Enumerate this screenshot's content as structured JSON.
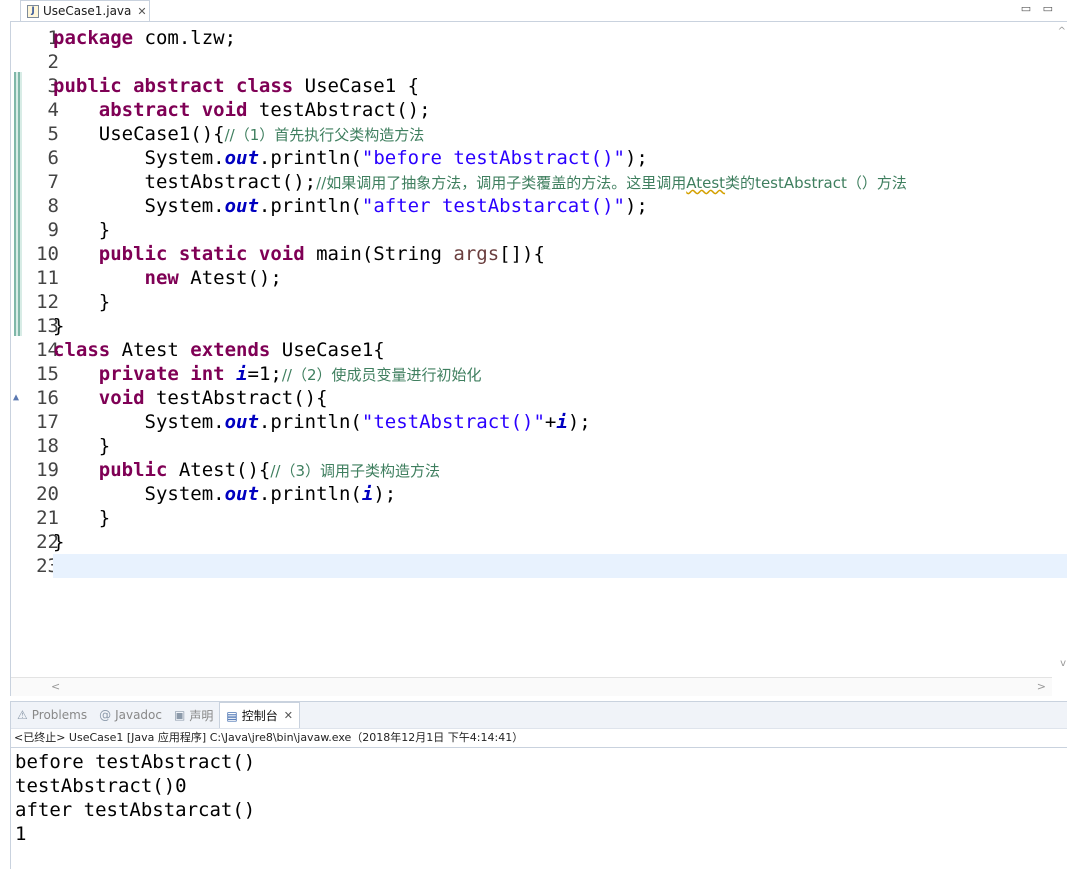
{
  "editor_tab": {
    "filename": "UseCase1.java",
    "close": "✕",
    "icon": "java-file-icon"
  },
  "window_controls": "▭ ▭",
  "code": {
    "lines": [
      {
        "n": "1",
        "segs": [
          {
            "t": "package",
            "c": "kw"
          },
          {
            "t": " com.lzw;",
            "c": ""
          }
        ]
      },
      {
        "n": "2",
        "segs": []
      },
      {
        "n": "3",
        "segs": [
          {
            "t": "public abstract class",
            "c": "kw"
          },
          {
            "t": " UseCase1 {",
            "c": ""
          }
        ]
      },
      {
        "n": "4",
        "segs": [
          {
            "t": "    ",
            "c": ""
          },
          {
            "t": "abstract void",
            "c": "kw"
          },
          {
            "t": " testAbstract();",
            "c": ""
          }
        ]
      },
      {
        "n": "5",
        "segs": [
          {
            "t": "    UseCase1(){",
            "c": ""
          },
          {
            "t": "//（1）首先执行父类构造方法",
            "c": "cm"
          }
        ]
      },
      {
        "n": "6",
        "segs": [
          {
            "t": "        System.",
            "c": ""
          },
          {
            "t": "out",
            "c": "fd"
          },
          {
            "t": ".println(",
            "c": ""
          },
          {
            "t": "\"before testAbstract()\"",
            "c": "st"
          },
          {
            "t": ");",
            "c": ""
          }
        ]
      },
      {
        "n": "7",
        "segs": [
          {
            "t": "        testAbstract();",
            "c": ""
          },
          {
            "t": "//如果调用了抽象方法，调用子类覆盖的方法。这里调用",
            "c": "cm"
          },
          {
            "t": "Atest",
            "c": "cm m sq"
          },
          {
            "t": "类的",
            "c": "cm"
          },
          {
            "t": "testAbstract",
            "c": "cm m"
          },
          {
            "t": "（）方法",
            "c": "cm"
          }
        ]
      },
      {
        "n": "8",
        "segs": [
          {
            "t": "        System.",
            "c": ""
          },
          {
            "t": "out",
            "c": "fd"
          },
          {
            "t": ".println(",
            "c": ""
          },
          {
            "t": "\"after testAbstarcat()\"",
            "c": "st"
          },
          {
            "t": ");",
            "c": ""
          }
        ]
      },
      {
        "n": "9",
        "segs": [
          {
            "t": "    }",
            "c": ""
          }
        ]
      },
      {
        "n": "10",
        "segs": [
          {
            "t": "    ",
            "c": ""
          },
          {
            "t": "public static void",
            "c": "kw"
          },
          {
            "t": " main(String ",
            "c": ""
          },
          {
            "t": "args",
            "c": "vr"
          },
          {
            "t": "[]){",
            "c": ""
          }
        ]
      },
      {
        "n": "11",
        "segs": [
          {
            "t": "        ",
            "c": ""
          },
          {
            "t": "new",
            "c": "kw"
          },
          {
            "t": " Atest();",
            "c": ""
          }
        ]
      },
      {
        "n": "12",
        "segs": [
          {
            "t": "    }",
            "c": ""
          }
        ]
      },
      {
        "n": "13",
        "segs": [
          {
            "t": "}",
            "c": ""
          }
        ]
      },
      {
        "n": "14",
        "segs": [
          {
            "t": "class",
            "c": "kw"
          },
          {
            "t": " Atest ",
            "c": ""
          },
          {
            "t": "extends",
            "c": "kw"
          },
          {
            "t": " UseCase1{",
            "c": ""
          }
        ]
      },
      {
        "n": "15",
        "segs": [
          {
            "t": "    ",
            "c": ""
          },
          {
            "t": "private int",
            "c": "kw"
          },
          {
            "t": " ",
            "c": ""
          },
          {
            "t": "i",
            "c": "fd"
          },
          {
            "t": "=1;",
            "c": ""
          },
          {
            "t": "//（2）使成员变量进行初始化",
            "c": "cm"
          }
        ]
      },
      {
        "n": "16",
        "segs": [
          {
            "t": "    ",
            "c": ""
          },
          {
            "t": "void",
            "c": "kw"
          },
          {
            "t": " testAbstract(){",
            "c": ""
          }
        ]
      },
      {
        "n": "17",
        "segs": [
          {
            "t": "        System.",
            "c": ""
          },
          {
            "t": "out",
            "c": "fd"
          },
          {
            "t": ".println(",
            "c": ""
          },
          {
            "t": "\"testAbstract()\"",
            "c": "st"
          },
          {
            "t": "+",
            "c": ""
          },
          {
            "t": "i",
            "c": "fd"
          },
          {
            "t": ");",
            "c": ""
          }
        ]
      },
      {
        "n": "18",
        "segs": [
          {
            "t": "    }",
            "c": ""
          }
        ]
      },
      {
        "n": "19",
        "segs": [
          {
            "t": "    ",
            "c": ""
          },
          {
            "t": "public",
            "c": "kw"
          },
          {
            "t": " Atest(){",
            "c": ""
          },
          {
            "t": "//（3）调用子类构造方法",
            "c": "cm"
          }
        ]
      },
      {
        "n": "20",
        "segs": [
          {
            "t": "        System.",
            "c": ""
          },
          {
            "t": "out",
            "c": "fd"
          },
          {
            "t": ".println(",
            "c": ""
          },
          {
            "t": "i",
            "c": "fd"
          },
          {
            "t": ");",
            "c": ""
          }
        ]
      },
      {
        "n": "21",
        "segs": [
          {
            "t": "    }",
            "c": ""
          }
        ]
      },
      {
        "n": "22",
        "segs": [
          {
            "t": "}",
            "c": ""
          }
        ]
      },
      {
        "n": "23",
        "segs": []
      }
    ],
    "current_line": "23",
    "override_marker_line": "16"
  },
  "console": {
    "tabs": [
      {
        "label": "Problems",
        "icon": "problems-icon",
        "glyph": "⚠"
      },
      {
        "label": "Javadoc",
        "icon": "javadoc-icon",
        "glyph": "@"
      },
      {
        "label": "声明",
        "icon": "declaration-icon",
        "glyph": "▣"
      },
      {
        "label": "控制台",
        "icon": "console-icon",
        "glyph": "▤",
        "active": true
      }
    ],
    "close": "✕",
    "status": "<已终止> UseCase1 [Java 应用程序] C:\\Java\\jre8\\bin\\javaw.exe（2018年12月1日 下午4:14:41）",
    "output": [
      "before testAbstract()",
      "testAbstract()0",
      "after testAbstarcat()",
      "1"
    ]
  }
}
